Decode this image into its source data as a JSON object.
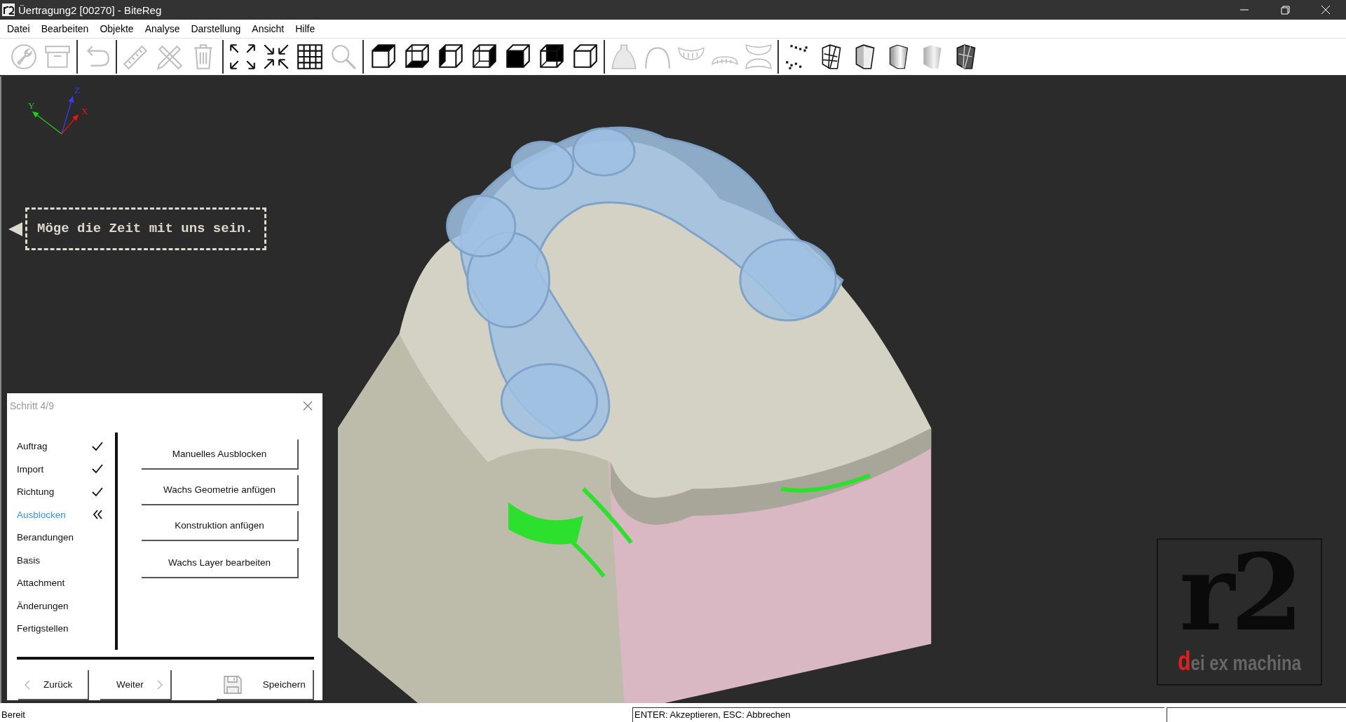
{
  "window": {
    "title": "Üertragung2 [00270] - BiteReg"
  },
  "menu": [
    "Datei",
    "Bearbeiten",
    "Objekte",
    "Analyse",
    "Darstellung",
    "Ansicht",
    "Hilfe"
  ],
  "toolbar": [
    [
      {
        "kind": "wrench",
        "disabled": true
      },
      {
        "kind": "box",
        "disabled": true
      }
    ],
    [
      {
        "kind": "undo",
        "disabled": true
      }
    ],
    [
      {
        "kind": "ruler",
        "disabled": true
      },
      {
        "kind": "pencil-ruler",
        "disabled": true
      },
      {
        "kind": "trash",
        "disabled": true
      }
    ],
    [
      {
        "kind": "expand",
        "disabled": false
      },
      {
        "kind": "compress",
        "disabled": false
      },
      {
        "kind": "grid",
        "disabled": false
      },
      {
        "kind": "search",
        "disabled": true
      }
    ],
    [
      {
        "kind": "cube-top",
        "disabled": false
      },
      {
        "kind": "cube-bottom",
        "disabled": false
      },
      {
        "kind": "cube-left",
        "disabled": false
      },
      {
        "kind": "cube-right",
        "disabled": false
      },
      {
        "kind": "cube-front",
        "disabled": false
      },
      {
        "kind": "cube-back",
        "disabled": false
      },
      {
        "kind": "cube-plain",
        "disabled": false
      }
    ],
    [
      {
        "kind": "dome-dotted",
        "disabled": true
      },
      {
        "kind": "dome",
        "disabled": true
      },
      {
        "kind": "teeth-upper",
        "disabled": true
      },
      {
        "kind": "teeth-lower",
        "disabled": true
      },
      {
        "kind": "teeth-both",
        "disabled": true
      }
    ],
    [
      {
        "kind": "points",
        "disabled": false
      },
      {
        "kind": "cylinder-wire",
        "disabled": false
      },
      {
        "kind": "cylinder-flat",
        "disabled": false
      },
      {
        "kind": "cylinder-smooth",
        "disabled": false
      },
      {
        "kind": "cylinder-soft",
        "disabled": false
      },
      {
        "kind": "cylinder-dark",
        "disabled": false
      }
    ]
  ],
  "viewport": {
    "axes": [
      {
        "label": "Z",
        "color": "#3a3aff"
      },
      {
        "label": "Y",
        "color": "#22cc22"
      },
      {
        "label": "X",
        "color": "#ee1111"
      }
    ],
    "hint": "Möge die Zeit mit uns sein.",
    "logo": {
      "mark": "r2",
      "tagline": "dei ex machina"
    }
  },
  "wizard": {
    "title": "Schritt 4/9",
    "steps": [
      {
        "label": "Auftrag",
        "checked": true,
        "selected": false
      },
      {
        "label": "Import",
        "checked": true,
        "selected": false
      },
      {
        "label": "Richtung",
        "checked": true,
        "selected": false
      },
      {
        "label": "Ausblocken",
        "checked": false,
        "selected": true
      },
      {
        "label": "Berandungen",
        "checked": false,
        "selected": false
      },
      {
        "label": "Basis",
        "checked": false,
        "selected": false
      },
      {
        "label": "Attachment",
        "checked": false,
        "selected": false
      },
      {
        "label": "Änderungen",
        "checked": false,
        "selected": false
      },
      {
        "label": "Fertigstellen",
        "checked": false,
        "selected": false
      }
    ],
    "actions": [
      "Manuelles Ausblocken",
      "Wachs Geometrie anfügen",
      "Konstruktion anfügen",
      "Wachs Layer bearbeiten"
    ],
    "back": "Zurück",
    "next": "Weiter",
    "save": "Speichern"
  },
  "status_bar": [
    "Bereit",
    "ENTER: Akzeptieren, ESC: Abbrechen"
  ]
}
